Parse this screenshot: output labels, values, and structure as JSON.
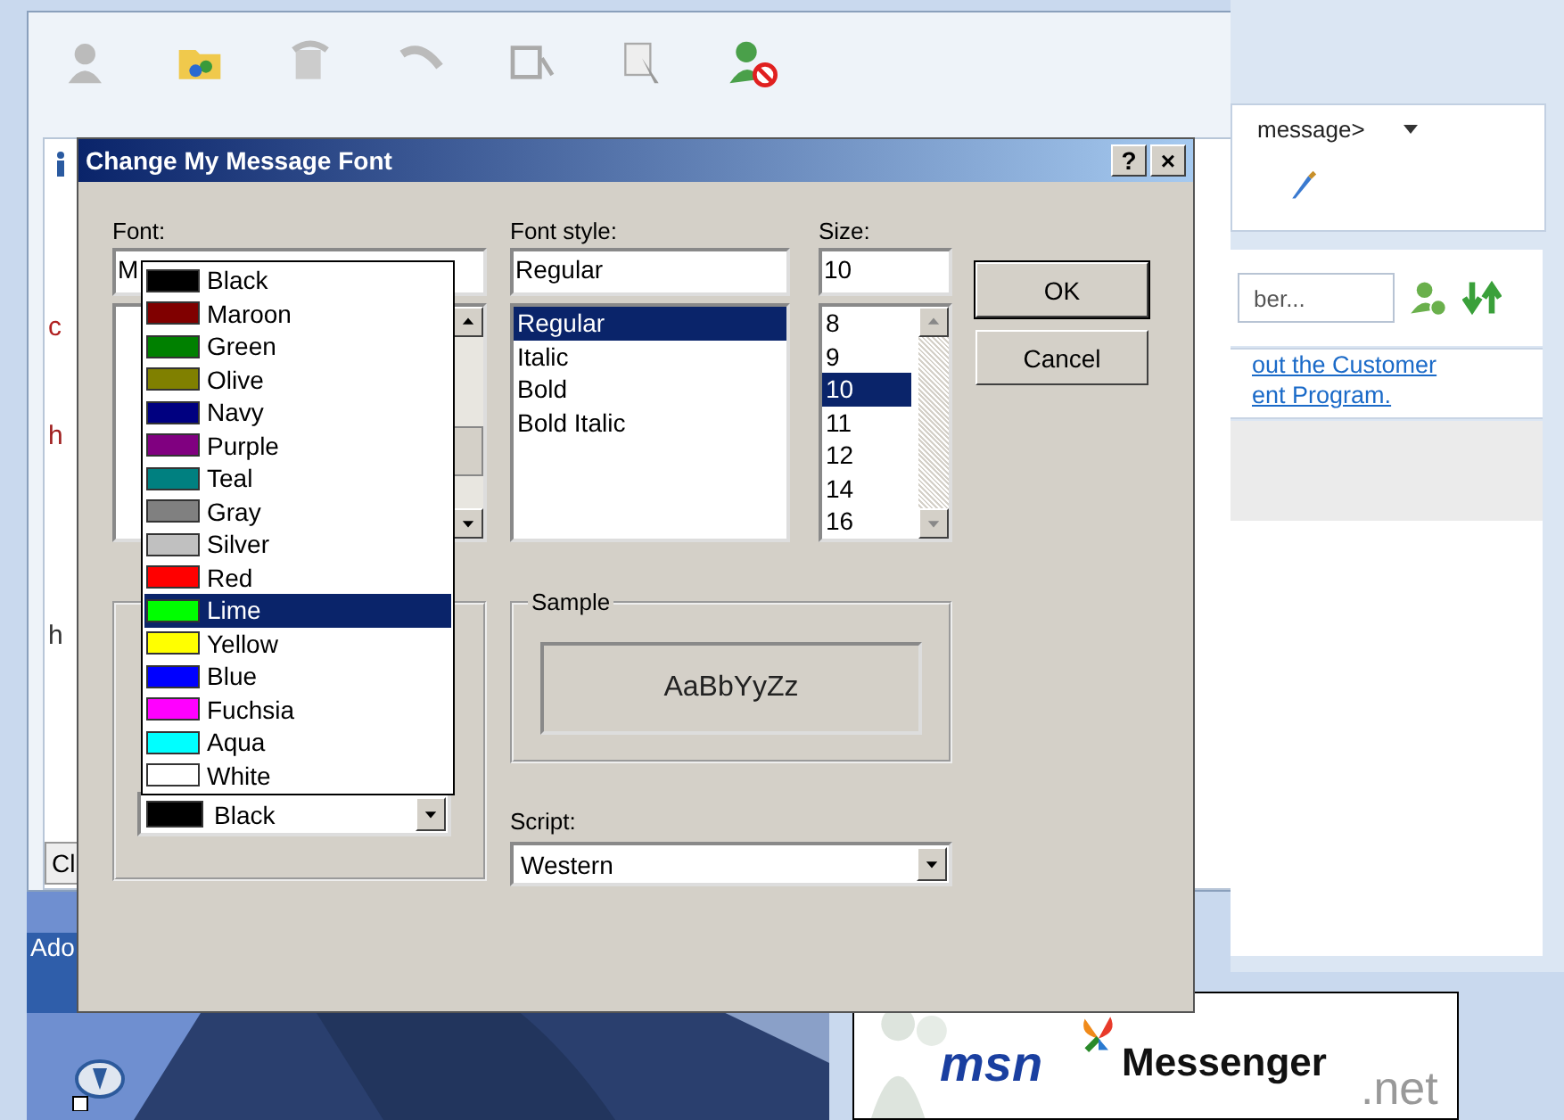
{
  "back_window": {
    "line_1": "c",
    "line_2": "h",
    "line_3": "h",
    "button": "Cl"
  },
  "desktop": {
    "icon_label": "Ado"
  },
  "side_panel": {
    "message_menu": "message>",
    "search": {
      "placeholder": "ber..."
    },
    "link_lines": [
      "out the Customer",
      "ent Program."
    ],
    "banner": {
      "brand": "msn",
      "product": "Messenger",
      "suffix": ".net"
    }
  },
  "dialog": {
    "title": "Change My Message Font",
    "help_button": "?",
    "close_button": "×",
    "font": {
      "label": "Font:",
      "value": "M"
    },
    "color_list": [
      {
        "name": "Black",
        "color": "#000000",
        "selected": false
      },
      {
        "name": "Maroon",
        "color": "#800000",
        "selected": false
      },
      {
        "name": "Green",
        "color": "#008000",
        "selected": false
      },
      {
        "name": "Olive",
        "color": "#808000",
        "selected": false
      },
      {
        "name": "Navy",
        "color": "#000080",
        "selected": false
      },
      {
        "name": "Purple",
        "color": "#800080",
        "selected": false
      },
      {
        "name": "Teal",
        "color": "#008080",
        "selected": false
      },
      {
        "name": "Gray",
        "color": "#808080",
        "selected": false
      },
      {
        "name": "Silver",
        "color": "#c0c0c0",
        "selected": false
      },
      {
        "name": "Red",
        "color": "#ff0000",
        "selected": false
      },
      {
        "name": "Lime",
        "color": "#00ff00",
        "selected": true
      },
      {
        "name": "Yellow",
        "color": "#ffff00",
        "selected": false
      },
      {
        "name": "Blue",
        "color": "#0000ff",
        "selected": false
      },
      {
        "name": "Fuchsia",
        "color": "#ff00ff",
        "selected": false
      },
      {
        "name": "Aqua",
        "color": "#00ffff",
        "selected": false
      },
      {
        "name": "White",
        "color": "#ffffff",
        "selected": false
      }
    ],
    "color_combo": {
      "value": "Black",
      "color": "#000000"
    },
    "font_style": {
      "label": "Font style:",
      "value": "Regular",
      "options": [
        {
          "label": "Regular",
          "selected": true
        },
        {
          "label": "Italic",
          "selected": false
        },
        {
          "label": "Bold",
          "selected": false
        },
        {
          "label": "Bold Italic",
          "selected": false
        }
      ]
    },
    "size": {
      "label": "Size:",
      "value": "10",
      "options": [
        {
          "label": "8",
          "selected": false
        },
        {
          "label": "9",
          "selected": false
        },
        {
          "label": "10",
          "selected": true
        },
        {
          "label": "11",
          "selected": false
        },
        {
          "label": "12",
          "selected": false
        },
        {
          "label": "14",
          "selected": false
        },
        {
          "label": "16",
          "selected": false
        }
      ]
    },
    "buttons": [
      "OK",
      "Cancel"
    ],
    "sample": {
      "label": "Sample",
      "text": "AaBbYyZz"
    },
    "script": {
      "label": "Script:",
      "value": "Western"
    }
  }
}
